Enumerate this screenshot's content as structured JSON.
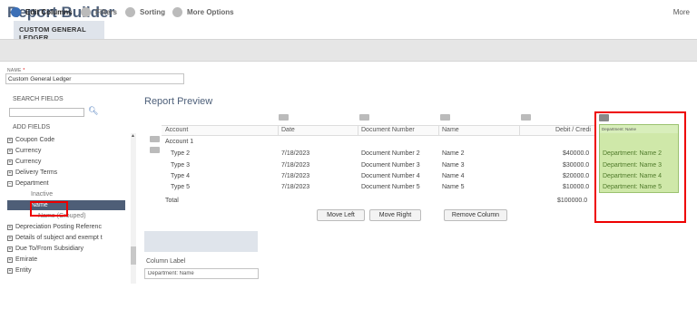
{
  "header": {
    "title": "Report Builder",
    "more": "More",
    "subtitle": "CUSTOM GENERAL LEDGER"
  },
  "tabs": [
    {
      "label": "Edit Columns",
      "active": true
    },
    {
      "label": "Filters",
      "active": false
    },
    {
      "label": "Sorting",
      "active": false
    },
    {
      "label": "More Options",
      "active": false
    }
  ],
  "name_field": {
    "label": "NAME",
    "required_mark": "*",
    "value": "Custom General Ledger"
  },
  "left_panel": {
    "search_label": "SEARCH FIELDS",
    "search_icon": "search-icon",
    "add_label": "ADD FIELDS",
    "fields": [
      "Coupon Code",
      "Currency",
      "Currency",
      "Delivery Terms",
      "Department",
      "Inactive",
      "Name",
      "Name (Grouped)",
      "Depreciation Posting Referenc",
      "Details of subject and exempt t",
      "Due To/From Subsidiary",
      "Emirate",
      "Entity"
    ]
  },
  "preview": {
    "title": "Report Preview",
    "columns": [
      "Account",
      "Date",
      "Document Number",
      "Name",
      "Debit / Credi"
    ],
    "group_row": "Account 1",
    "rows": [
      [
        "Type 2",
        "7/18/2023",
        "Document Number 2",
        "Name 2",
        "$40000.0"
      ],
      [
        "Type 3",
        "7/18/2023",
        "Document Number 3",
        "Name 3",
        "$30000.0"
      ],
      [
        "Type 4",
        "7/18/2023",
        "Document Number 4",
        "Name 4",
        "$20000.0"
      ],
      [
        "Type 5",
        "7/18/2023",
        "Document Number 5",
        "Name 5",
        "$10000.0"
      ]
    ],
    "total_label": "Total",
    "total_value": "$100000.0",
    "new_column": {
      "header": "Department: Name",
      "cells": [
        "Department: Name 2",
        "Department: Name 3",
        "Department: Name 4",
        "Department: Name 5"
      ]
    },
    "buttons": {
      "move_left": "Move Left",
      "move_right": "Move Right",
      "remove_column": "Remove Column"
    }
  },
  "column_label": {
    "label": "Column Label",
    "value": "Department: Name"
  }
}
